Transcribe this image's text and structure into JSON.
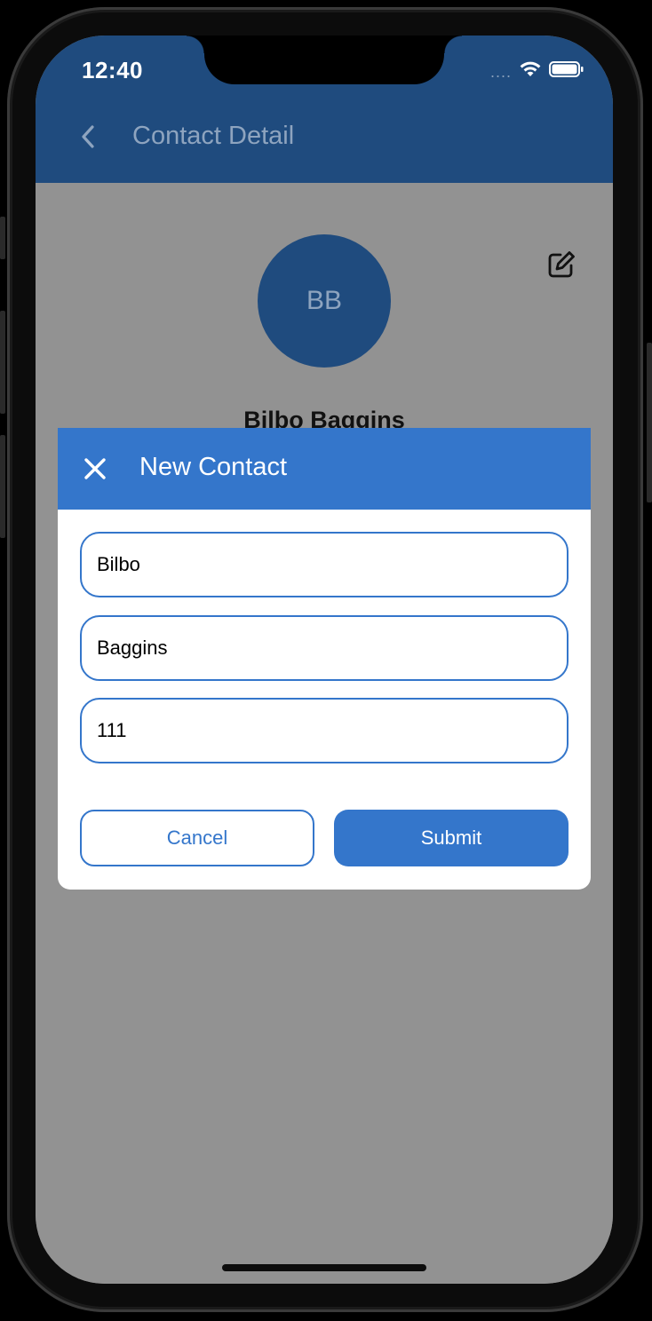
{
  "status_bar": {
    "time": "12:40",
    "signal_dots": "....",
    "icons": [
      "wifi-icon",
      "battery-icon"
    ]
  },
  "navbar": {
    "back_icon": "chevron-left-icon",
    "title": "Contact Detail"
  },
  "contact": {
    "initials": "BB",
    "name": "Bilbo Baggins",
    "edit_icon": "edit-icon"
  },
  "modal": {
    "close_icon": "close-icon",
    "title": "New Contact",
    "fields": {
      "first_name": "Bilbo",
      "last_name": "Baggins",
      "phone": "111"
    },
    "cancel_label": "Cancel",
    "submit_label": "Submit"
  },
  "colors": {
    "navbar": "#1f4b7e",
    "modal_header": "#3476cb",
    "overlay": "#929292",
    "accent": "#3476cb"
  }
}
